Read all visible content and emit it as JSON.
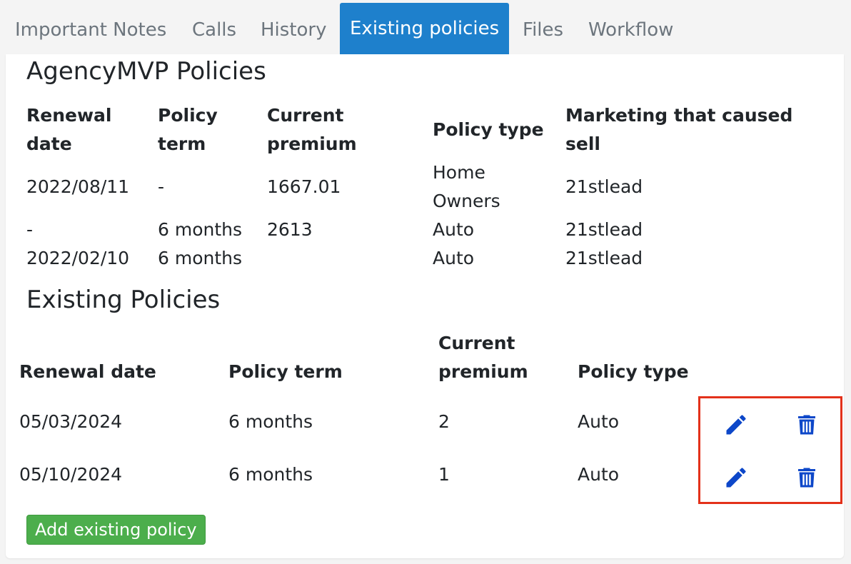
{
  "tabs": [
    {
      "label": "Important Notes"
    },
    {
      "label": "Calls"
    },
    {
      "label": "History"
    },
    {
      "label": "Existing policies"
    },
    {
      "label": "Files"
    },
    {
      "label": "Workflow"
    }
  ],
  "agency_section": {
    "title": "AgencyMVP Policies",
    "headers": {
      "renewal_line1": "Renewal",
      "renewal_line2": "date",
      "term_line1": "Policy",
      "term_line2": "term",
      "premium_line1": "Current",
      "premium_line2": "premium",
      "type": "Policy type",
      "marketing_line1": "Marketing that caused",
      "marketing_line2": "sell"
    },
    "rows": [
      {
        "renewal": "2022/08/11",
        "term": "-",
        "premium": "1667.01",
        "type_line1": "Home",
        "type_line2": "Owners",
        "marketing": "21stlead"
      },
      {
        "renewal": "-",
        "term": "6 months",
        "premium": "2613",
        "type": "Auto",
        "marketing": "21stlead"
      },
      {
        "renewal": "2022/02/10",
        "term": "6 months",
        "premium": "",
        "type": "Auto",
        "marketing": "21stlead"
      }
    ]
  },
  "existing_section": {
    "title": "Existing Policies",
    "headers": {
      "renewal": "Renewal date",
      "term": "Policy term",
      "premium_line1": "Current",
      "premium_line2": "premium",
      "type": "Policy type"
    },
    "rows": [
      {
        "renewal": "05/03/2024",
        "term": "6 months",
        "premium": "2",
        "type": "Auto"
      },
      {
        "renewal": "05/10/2024",
        "term": "6 months",
        "premium": "1",
        "type": "Auto"
      }
    ],
    "add_button_label": "Add existing policy"
  },
  "icons": {
    "edit": "pencil-icon",
    "delete": "trash-icon"
  },
  "colors": {
    "tab_active_bg": "#1e80cc",
    "icon_blue": "#0d47c9",
    "add_button_bg": "#4cae4c",
    "highlight_border": "#e3311a"
  }
}
